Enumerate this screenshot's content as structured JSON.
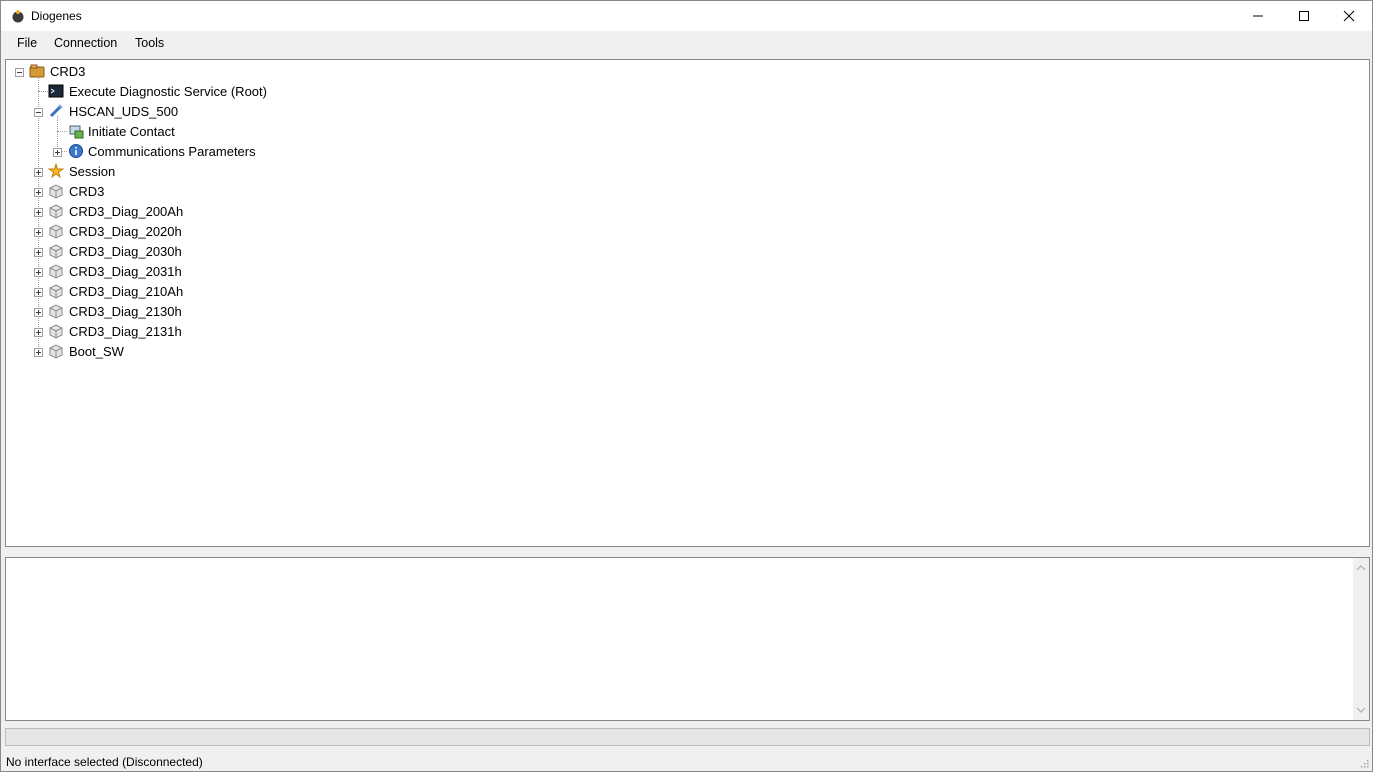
{
  "window": {
    "title": "Diogenes"
  },
  "menu": {
    "items": [
      "File",
      "Connection",
      "Tools"
    ]
  },
  "tree": {
    "root": "CRD3",
    "items": [
      {
        "label": "Execute Diagnostic Service (Root)",
        "icon": "terminal-icon"
      },
      {
        "label": "HSCAN_UDS_500",
        "icon": "connector-icon"
      },
      {
        "label": "Initiate Contact",
        "icon": "network-icon"
      },
      {
        "label": "Communications Parameters",
        "icon": "info-icon"
      },
      {
        "label": "Session",
        "icon": "star-icon"
      },
      {
        "label": "CRD3",
        "icon": "box-icon"
      },
      {
        "label": "CRD3_Diag_200Ah",
        "icon": "box-icon"
      },
      {
        "label": "CRD3_Diag_2020h",
        "icon": "box-icon"
      },
      {
        "label": "CRD3_Diag_2030h",
        "icon": "box-icon"
      },
      {
        "label": "CRD3_Diag_2031h",
        "icon": "box-icon"
      },
      {
        "label": "CRD3_Diag_210Ah",
        "icon": "box-icon"
      },
      {
        "label": "CRD3_Diag_2130h",
        "icon": "box-icon"
      },
      {
        "label": "CRD3_Diag_2131h",
        "icon": "box-icon"
      },
      {
        "label": "Boot_SW",
        "icon": "box-icon"
      }
    ]
  },
  "status": {
    "text": "No interface selected (Disconnected)"
  }
}
